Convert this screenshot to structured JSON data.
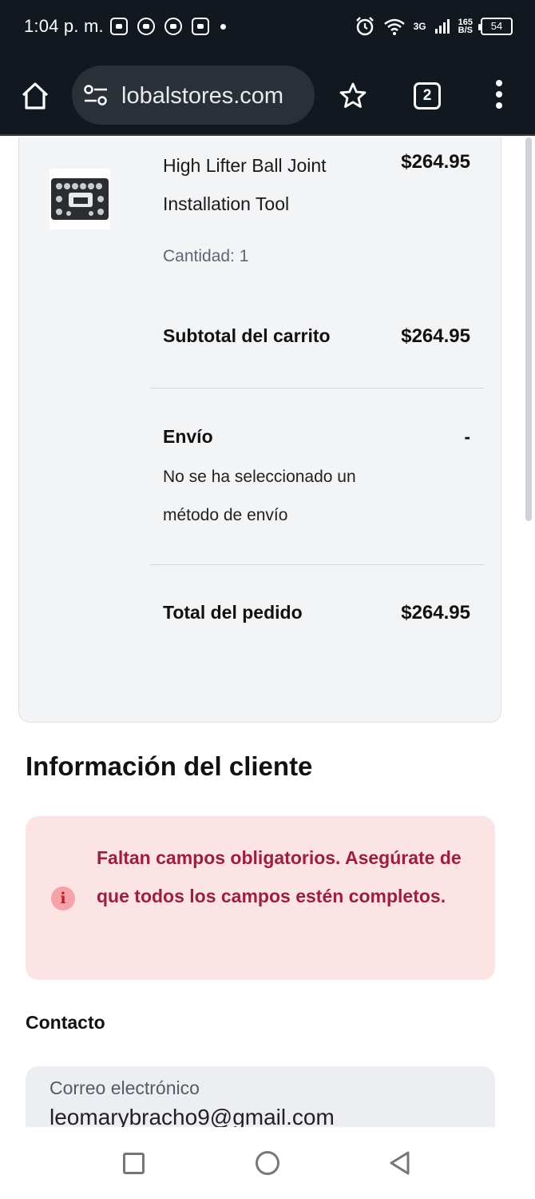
{
  "status_bar": {
    "time": "1:04 p. m.",
    "network": "3G",
    "speed_top": "165",
    "speed_bottom": "B/S",
    "battery": "54"
  },
  "browser": {
    "url": "lobalstores.com",
    "tab_count": "2"
  },
  "order_summary": {
    "product_name": "High Lifter Ball Joint Installation Tool",
    "product_price": "$264.95",
    "quantity": "Cantidad: 1",
    "subtotal_label": "Subtotal del carrito",
    "subtotal_value": "$264.95",
    "shipping_label": "Envío",
    "shipping_value": "-",
    "shipping_note": "No se ha seleccionado un método de envío",
    "total_label": "Total del pedido",
    "total_value": "$264.95"
  },
  "customer": {
    "title": "Información del cliente",
    "error_message": "Faltan campos obligatorios. Asegúrate de que todos los campos estén completos.",
    "contact_label": "Contacto",
    "email_label": "Correo electrónico",
    "email_value": "leomarybracho9@gmail.com"
  },
  "colors": {
    "system_bar": "#111820",
    "error_bg": "#fce3e4",
    "error_text": "#9b1f3f",
    "card_bg": "#f3f4f6"
  }
}
